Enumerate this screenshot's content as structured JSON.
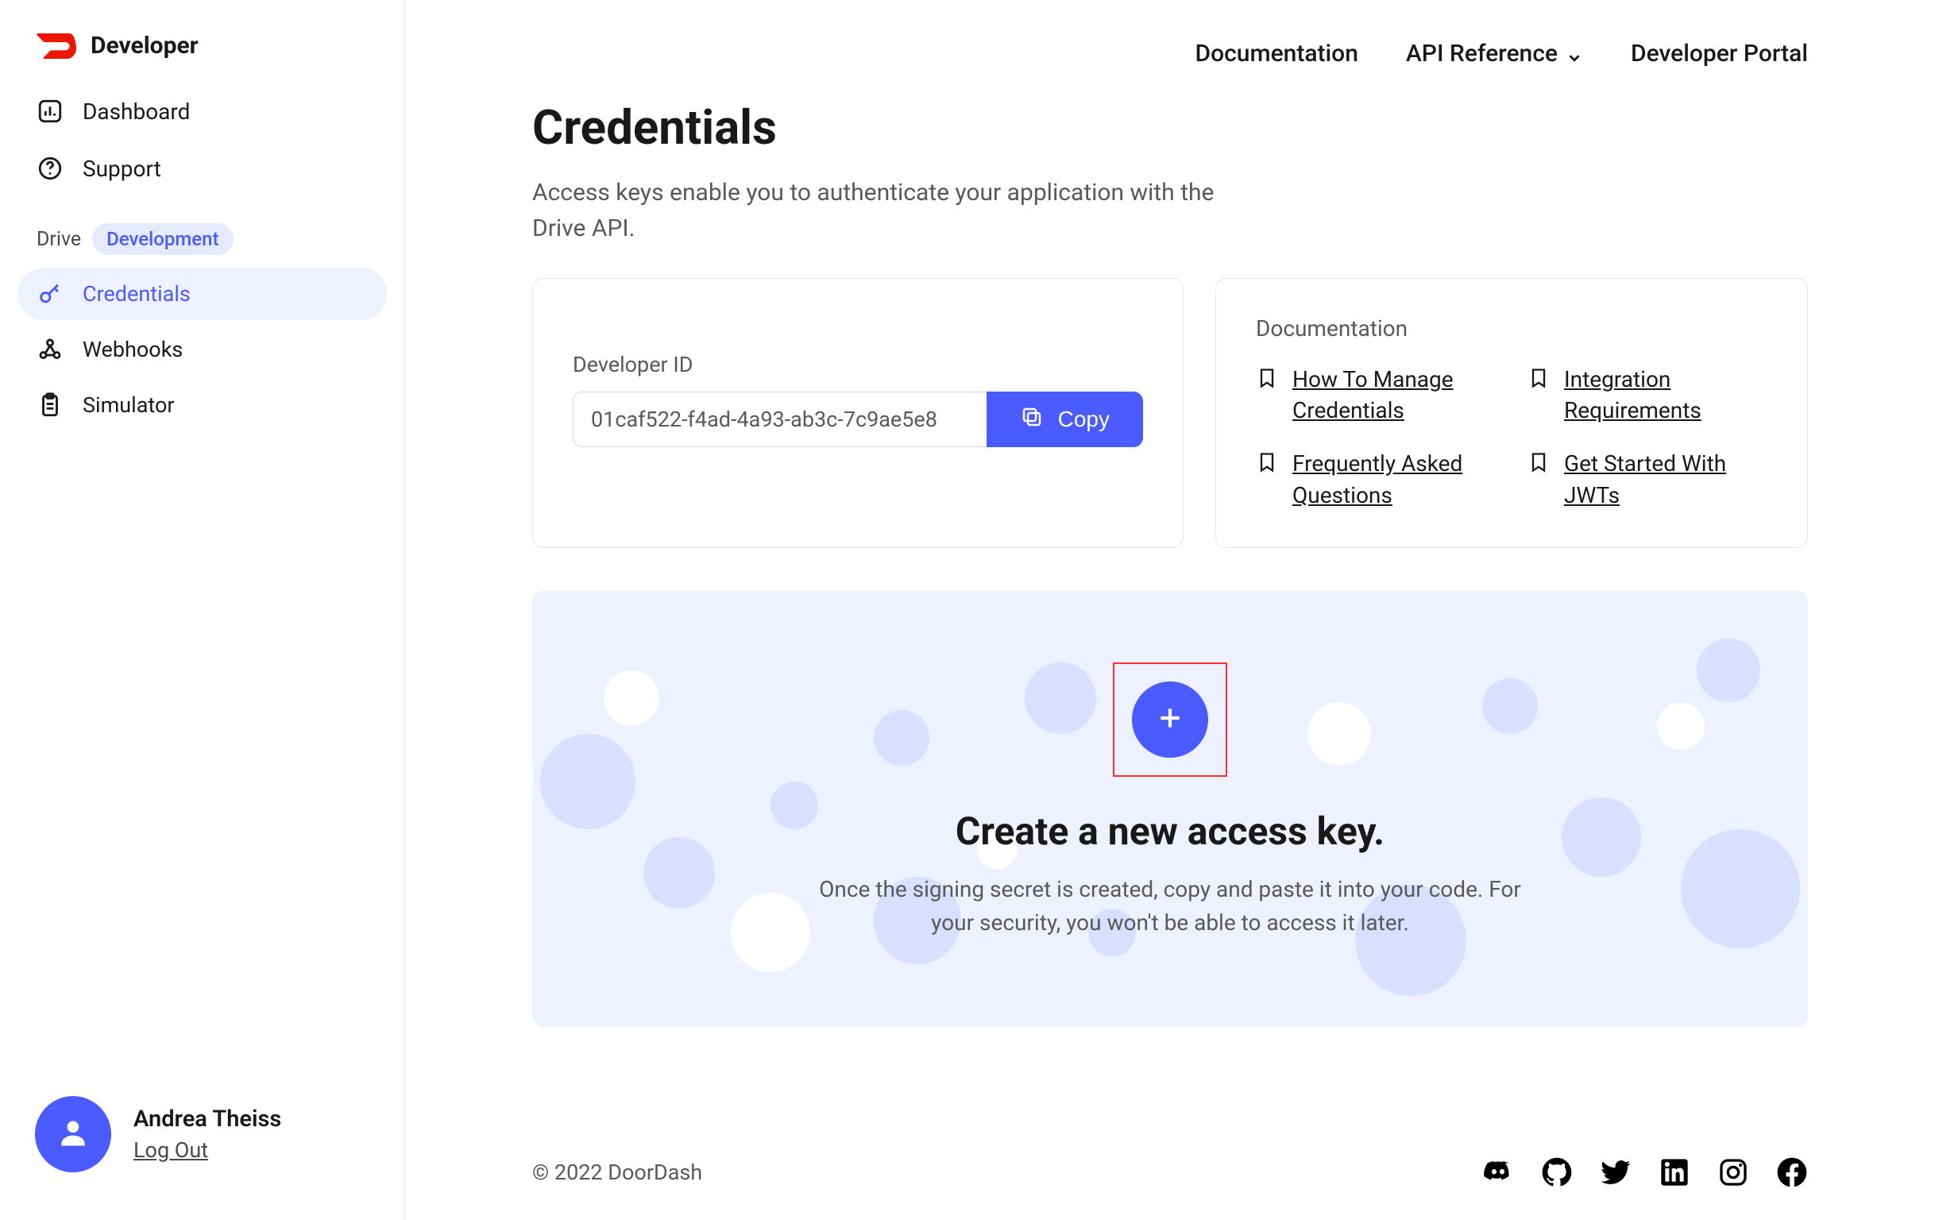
{
  "brand": {
    "name": "Developer"
  },
  "nav": {
    "dashboard": "Dashboard",
    "support": "Support"
  },
  "section": {
    "label": "Drive",
    "badge": "Development"
  },
  "subnav": {
    "credentials": "Credentials",
    "webhooks": "Webhooks",
    "simulator": "Simulator"
  },
  "user": {
    "name": "Andrea Theiss",
    "logout": "Log Out"
  },
  "topnav": {
    "documentation": "Documentation",
    "api_reference": "API Reference",
    "developer_portal": "Developer Portal"
  },
  "page": {
    "title": "Credentials",
    "subtitle": "Access keys enable you to authenticate your application with the Drive API."
  },
  "devid": {
    "label": "Developer ID",
    "value": "01caf522-f4ad-4a93-ab3c-7c9ae5e8",
    "copy": "Copy"
  },
  "docs": {
    "title": "Documentation",
    "links": {
      "manage": "How To Manage Credentials",
      "integration": "Integration Requirements",
      "faq": "Frequently Asked Questions",
      "jwts": "Get Started With JWTs"
    }
  },
  "create": {
    "title": "Create a new access key.",
    "desc": "Once the signing secret is created, copy and paste it into your code. For your security, you won't be able to access it later."
  },
  "footer": {
    "copyright": "© 2022 DoorDash"
  }
}
